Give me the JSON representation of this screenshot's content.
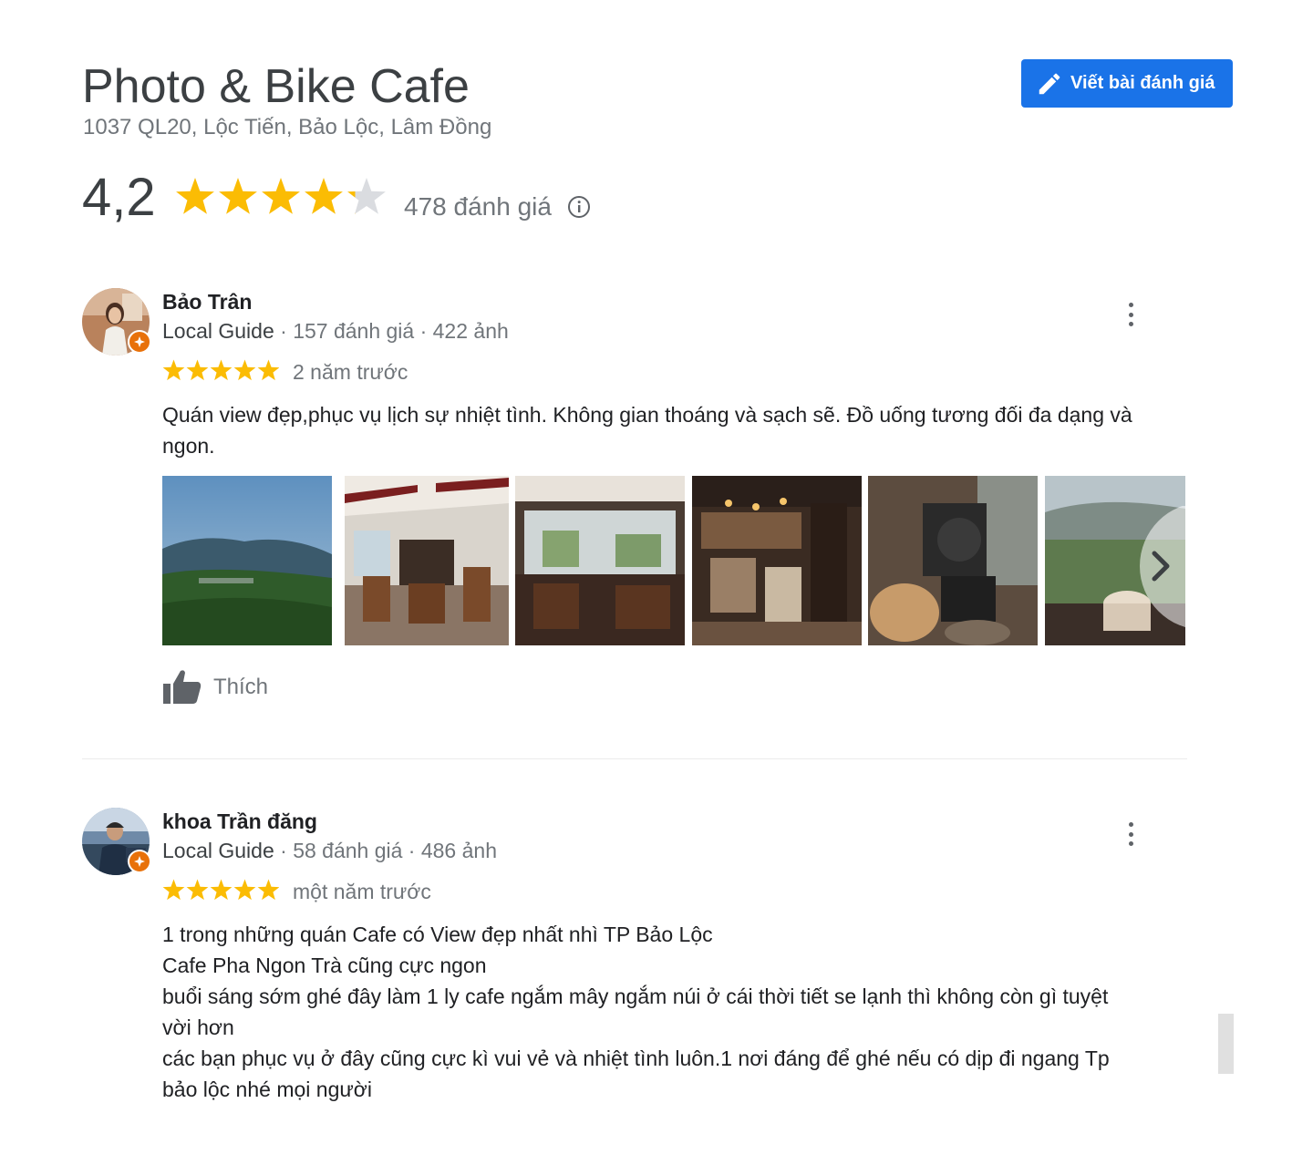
{
  "place": {
    "title": "Photo & Bike Cafe",
    "address": "1037 QL20, Lộc Tiến, Bảo Lộc, Lâm Đồng",
    "write_review_label": "Viết bài đánh giá",
    "rating_value": "4,2",
    "rating_stars": 4.2,
    "review_count": "478 đánh giá"
  },
  "reviews": [
    {
      "name": "Bảo Trân",
      "guide": "Local Guide",
      "stats": " · 157 đánh giá · 422 ảnh",
      "stars": 5,
      "time": "2 năm trước",
      "text": "Quán view đẹp,phục vụ lịch sự nhiệt tình. Không gian thoáng và sạch sẽ. Đồ uống tương đối đa dạng và\nngon.",
      "like_label": "Thích",
      "photos": [
        "mountain-view",
        "cafe-interior",
        "cafe-seating",
        "coffee-bar",
        "coffee-roaster",
        "valley-view-coffee"
      ]
    },
    {
      "name": "khoa Trần đăng",
      "guide": "Local Guide",
      "stats": " · 58 đánh giá · 486 ảnh",
      "stars": 5,
      "time": "một năm trước",
      "text": "1 trong những quán Cafe có View đẹp nhất nhì TP Bảo Lộc\nCafe Pha Ngon Trà cũng cực ngon\nbuổi sáng sớm ghé đây làm 1 ly cafe ngắm mây ngắm núi ở cái thời tiết se lạnh thì không còn gì tuyệt\nvời hơn\ncác bạn phục vụ ở đây cũng cực kì vui vẻ và nhiệt tình luôn.1 nơi đáng để ghé nếu có dịp đi ngang Tp\nbảo lộc nhé mọi người"
    }
  ],
  "colors": {
    "star": "#fbbc04",
    "star_empty": "#dadce0",
    "button": "#1a73e8",
    "badge": "#e8710a"
  }
}
